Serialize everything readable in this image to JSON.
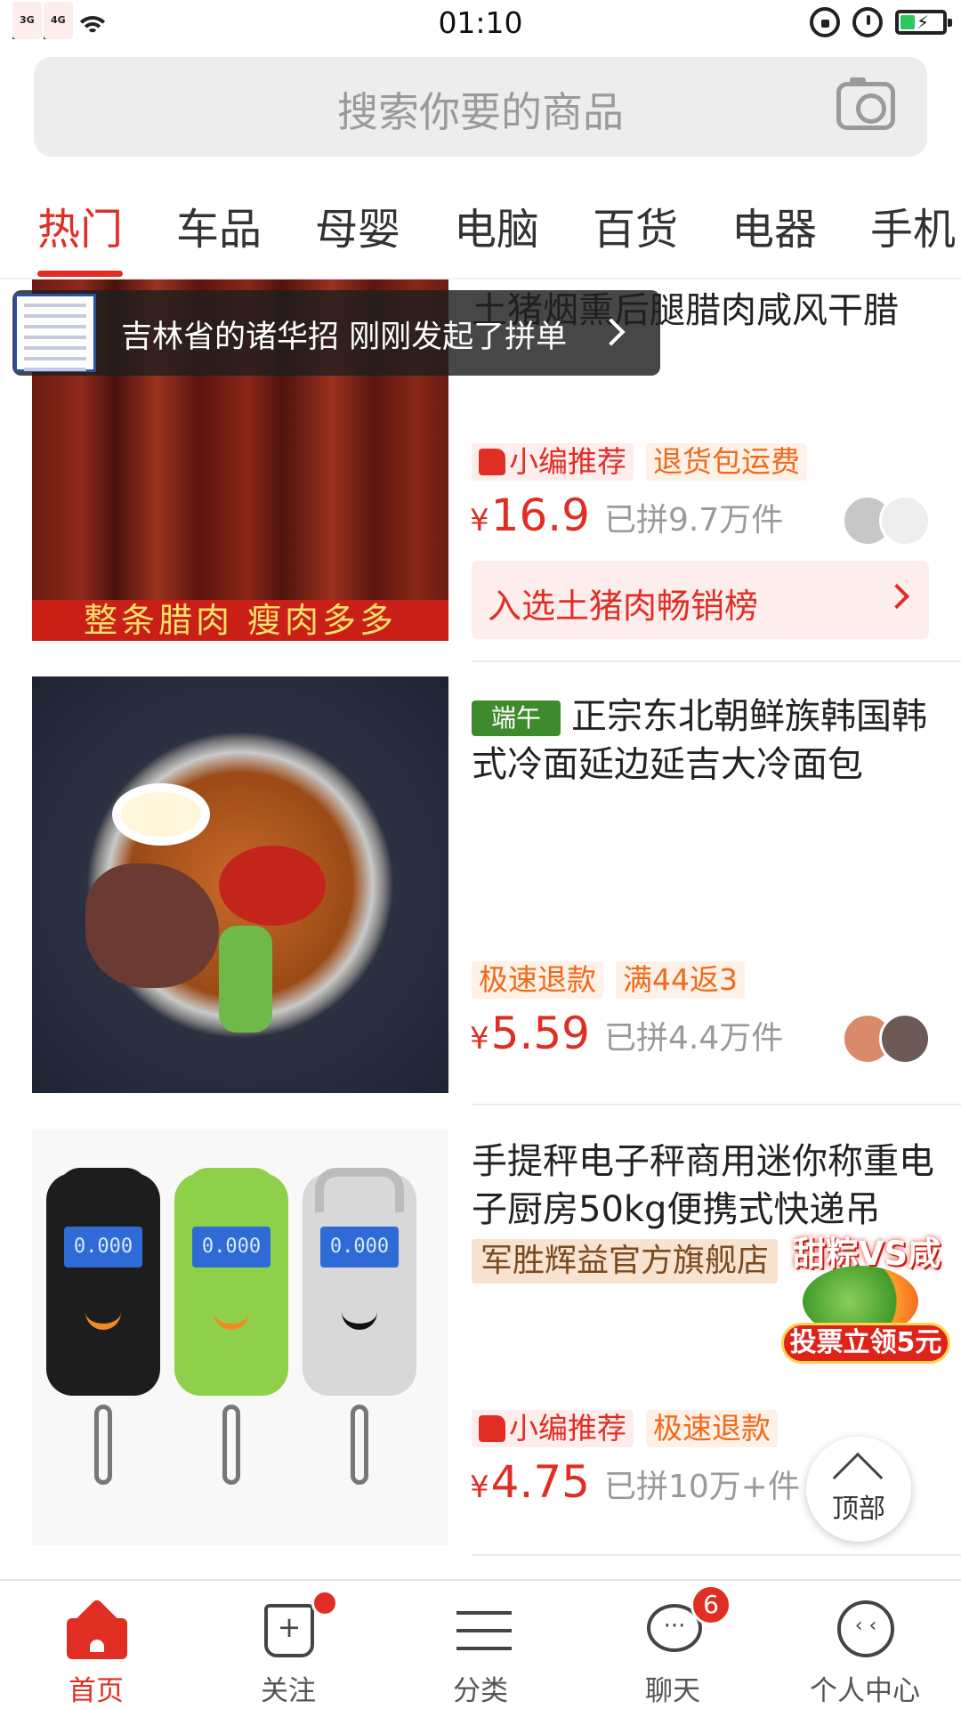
{
  "status_bar": {
    "time": "01:10",
    "network_1": "3G",
    "network_2": "4G"
  },
  "search": {
    "placeholder": "搜索你要的商品",
    "icon": "camera-icon"
  },
  "tabs": [
    {
      "label": "热门",
      "active": true
    },
    {
      "label": "车品",
      "active": false
    },
    {
      "label": "母婴",
      "active": false
    },
    {
      "label": "电脑",
      "active": false
    },
    {
      "label": "百货",
      "active": false
    },
    {
      "label": "电器",
      "active": false
    },
    {
      "label": "手机",
      "active": false
    }
  ],
  "toast": {
    "text": "吉林省的诸华招 刚刚发起了拼单"
  },
  "products": [
    {
      "title": "土猪烟熏后腿腊肉咸风干腊",
      "image_banner": "整条腊肉    瘦肉多多",
      "tags": [
        "小编推荐",
        "退货包运费"
      ],
      "currency": "¥",
      "price": "16.9",
      "sold": "已拼9.7万件",
      "rank_text": "入选土猪肉畅销榜"
    },
    {
      "badge": "端午",
      "title": "正宗东北朝鲜族韩国韩式冷面延边延吉大冷面包",
      "tags": [
        "极速退款",
        "满44返3"
      ],
      "currency": "¥",
      "price": "5.59",
      "sold": "已拼4.4万件"
    },
    {
      "title": "手提秤电子秤商用迷你称重电子厨房50kg便携式快递吊",
      "store": "军胜辉益官方旗舰店",
      "tags": [
        "小编推荐",
        "极速退款"
      ],
      "currency": "¥",
      "price": "4.75",
      "sold": "已拼10万+件",
      "scale_screen": "0.000"
    }
  ],
  "promo": {
    "title": "甜粽VS咸粽",
    "button": "投票立领5元"
  },
  "back_to_top": "顶部",
  "bottom_nav": [
    {
      "label": "首页",
      "icon": "home-icon",
      "active": true
    },
    {
      "label": "关注",
      "icon": "follow-icon",
      "active": false
    },
    {
      "label": "分类",
      "icon": "category-icon",
      "active": false
    },
    {
      "label": "聊天",
      "icon": "chat-icon",
      "active": false,
      "badge": "6"
    },
    {
      "label": "个人中心",
      "icon": "profile-icon",
      "active": false
    }
  ],
  "colors": {
    "accent": "#e02e24",
    "tag_orange": "#f06a1b",
    "muted": "#9a9a9a"
  }
}
